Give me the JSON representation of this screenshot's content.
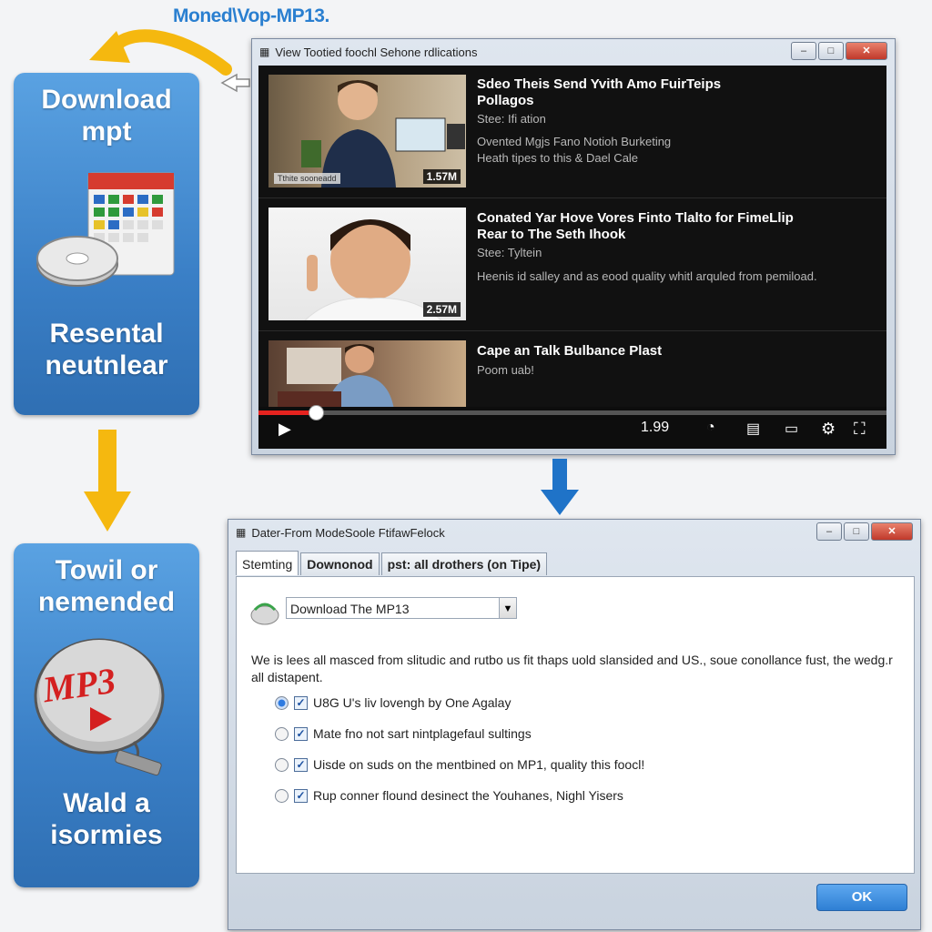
{
  "caption": "Moned\\Vop-MP13.",
  "panel_top": {
    "line1": "Download",
    "line2": "mpt",
    "line3": "Resental",
    "line4": "neutnlear"
  },
  "panel_bottom": {
    "line1": "Towil or",
    "line2": "nemended",
    "line3": "Wald a",
    "line4": "isormies",
    "logo_text": "MP3"
  },
  "player_window": {
    "title": "View Tootied foochl Sehone rdlications",
    "videos": [
      {
        "title1": "Sdeo Theis Send Yvith Amo FuirTeips",
        "title2": "Pollagos",
        "meta1": "Stee: Ifi ation",
        "meta2": "Ovented Mgjs Fano Notioh Burketing",
        "meta3": "Heath tipes to this & Dael Cale",
        "duration": "1.57M",
        "thumb_caption": "Tthite sooneadd"
      },
      {
        "title1": "Conated Yar Hove Vores Finto Tlalto for FimeLlip",
        "title2": "Rear to The Seth Ihook",
        "meta1": "Stee: Tyltein",
        "meta2": "Heenis id salley and as eood quality whitl arquled from pemiload.",
        "duration": "2.57M"
      },
      {
        "title1": "Cape an Talk Bulbance Plast",
        "meta1": "Poom uab!"
      }
    ],
    "player": {
      "time": "1.99",
      "progress": 0.09
    }
  },
  "dialog": {
    "title": "Dater-From ModeSoole FtifawFelock",
    "tabs": [
      "Stemting",
      "Downonod",
      "pst: all drothers (on Tipe)"
    ],
    "dropdown_value": "Download The MP13",
    "description": "We is lees all masced from slitudic and rutbo us fit thaps uold slansided and US., soue conollance fust, the wedg.r all distapent.",
    "options": [
      {
        "label": "U8G U's liv lovengh by One Agalay",
        "selected": true,
        "checked": true
      },
      {
        "label": "Mate fno not sart nintplagefaul sultings",
        "selected": false,
        "checked": true
      },
      {
        "label": "Uisde on suds on the mentbined on MP1, quality this foocl!",
        "selected": false,
        "checked": true
      },
      {
        "label": "Rup conner flound desinect the Youhanes, Nighl Yisers",
        "selected": false,
        "checked": true
      }
    ],
    "ok_label": "OK"
  },
  "colors": {
    "accent": "#2a7fd0",
    "arrow_yellow": "#f5b80f",
    "arrow_blue": "#1f73c8",
    "progress_red": "#e5231f"
  }
}
